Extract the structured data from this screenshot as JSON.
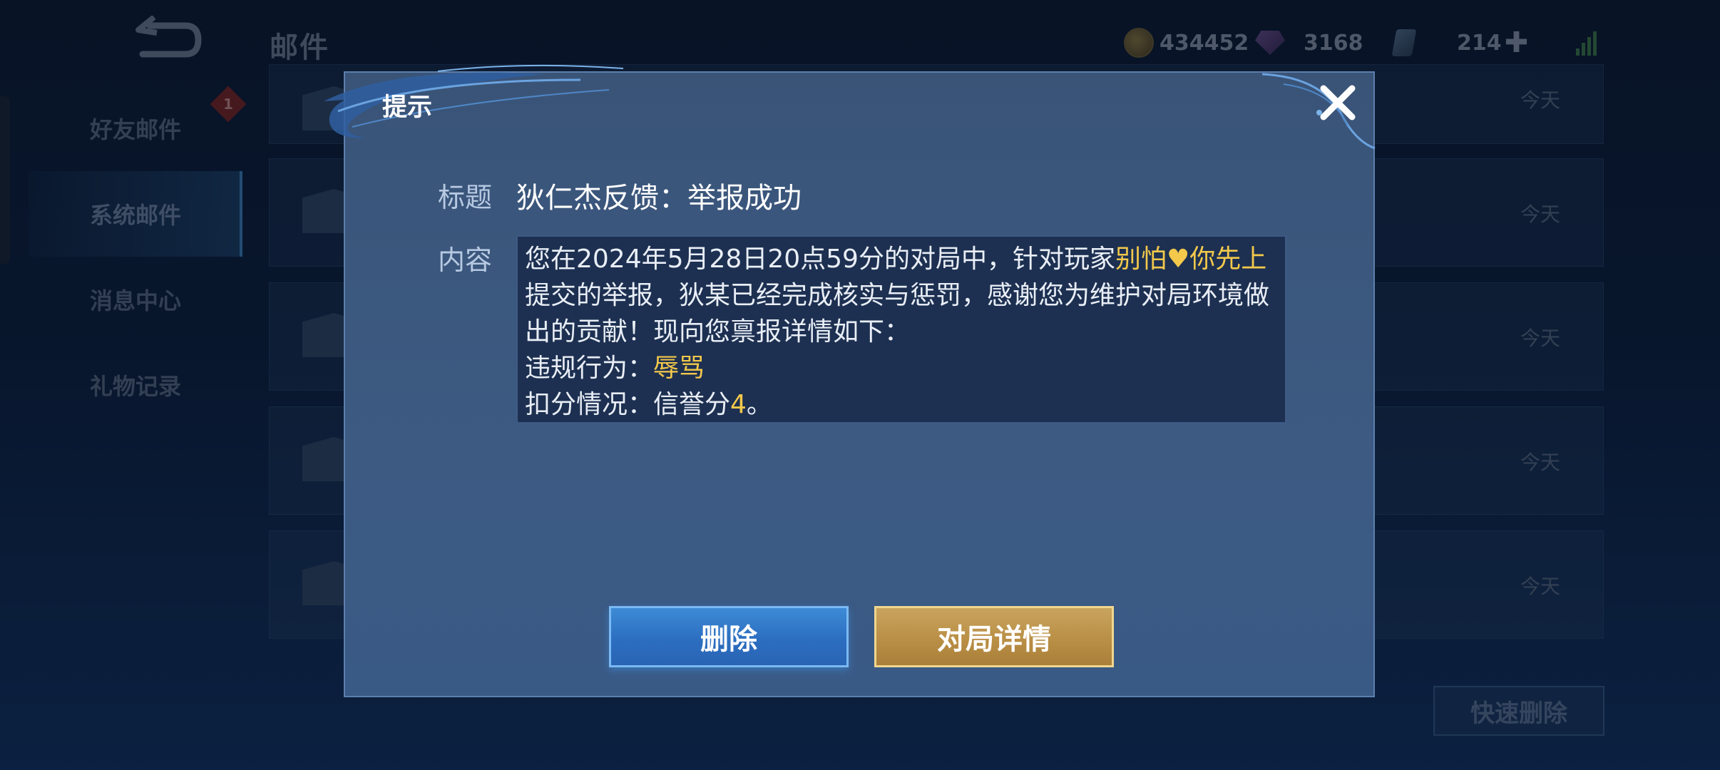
{
  "header": {
    "title": "邮件",
    "currencies": {
      "gold": "434452",
      "gems": "3168",
      "vouchers": "214"
    }
  },
  "sidebar": {
    "items": [
      {
        "label": "好友邮件",
        "badge": "1"
      },
      {
        "label": "系统邮件"
      },
      {
        "label": "消息中心"
      },
      {
        "label": "礼物记录"
      }
    ]
  },
  "mail_list": {
    "dates": [
      "今天",
      "今天",
      "今天",
      "今天",
      "今天"
    ],
    "quick_delete_label": "快速删除"
  },
  "dialog": {
    "title": "提示",
    "subject_label": "标题",
    "subject": "狄仁杰反馈：举报成功",
    "content_label": "内容",
    "content": {
      "p1": "您在2024年5月28日20点59分的对局中，针对玩家",
      "player": "别怕♥你先上",
      "p2": "提交的举报，狄某已经完成核实与惩罚，感谢您为维护对局环境做出的贡献！现向您禀报详情如下：",
      "violation_label": "违规行为：",
      "violation": "辱骂",
      "deduction_label": "扣分情况：信誉分",
      "deduction": "4",
      "deduction_suffix": "。"
    },
    "delete_label": "删除",
    "details_label": "对局详情"
  },
  "colors": {
    "highlight": "#f3c84b",
    "primary_button": "#2c6ec0",
    "gold_button": "#b88d44"
  }
}
